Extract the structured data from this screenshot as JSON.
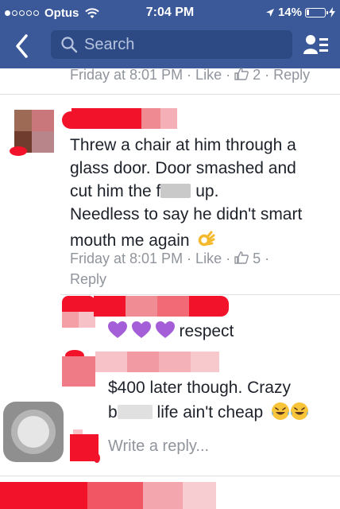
{
  "status_bar": {
    "carrier": "Optus",
    "time": "7:04 PM",
    "battery_percent": "14%",
    "battery_level": 0.14
  },
  "nav": {
    "search_placeholder": "Search"
  },
  "comments": [
    {
      "meta": "Friday at 8:01 PM · Like · ",
      "like_count": "2",
      "reply_label": " · Reply"
    },
    {
      "text_line1": "Threw a chair at him through a",
      "text_line2": "glass door. Door smashed and",
      "text_line3_a": "cut him the f",
      "text_line3_b": " up.",
      "text_line4": "Needless to say he didn't smart",
      "text_line5": "mouth me again",
      "meta_line1": "Friday at 8:01 PM · Like · ",
      "like_count": "5",
      "meta_sep": " ·",
      "reply_label": "Reply"
    },
    {
      "text": "respect"
    },
    {
      "text_line1": "$400 later though. Crazy",
      "text_line2_a": "b",
      "text_line2_b": " life ain't cheap"
    }
  ],
  "reply_input": {
    "placeholder": "Write a reply..."
  },
  "colors": {
    "brand": "#3b5998",
    "redaction": "#f2132a",
    "meta_text": "#90949c"
  },
  "icons": [
    "back-chevron-icon",
    "search-icon",
    "friend-requests-icon",
    "like-icon",
    "wifi-icon",
    "location-arrow-icon",
    "battery-icon",
    "ok-hand-emoji-icon",
    "purple-heart-emoji-icon",
    "laughing-emoji-icon",
    "assistive-touch-icon"
  ]
}
